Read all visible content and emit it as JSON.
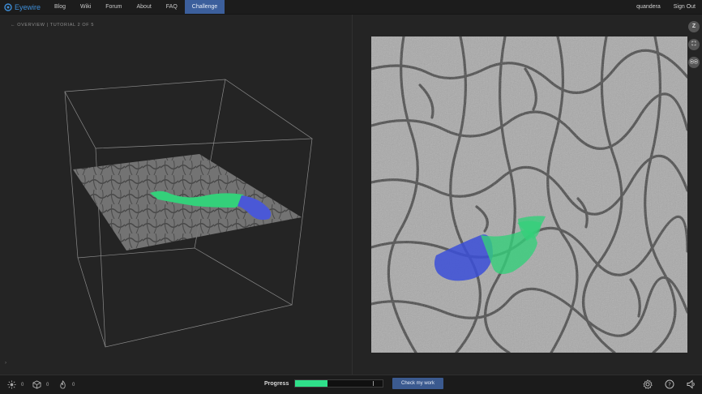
{
  "header": {
    "logo_text": "Eyewire",
    "nav": [
      {
        "label": "Blog"
      },
      {
        "label": "Wiki"
      },
      {
        "label": "Forum"
      },
      {
        "label": "About"
      },
      {
        "label": "FAQ"
      },
      {
        "label": "Challenge",
        "active": true
      }
    ],
    "username": "quandera",
    "sign_out": "Sign Out"
  },
  "left_panel": {
    "breadcrumb": "← OVERVIEW | TUTORIAL 2 OF 5",
    "collapse_arrow": "›"
  },
  "right_panel": {
    "buttons": [
      {
        "name": "z-button",
        "label": "Z"
      },
      {
        "name": "fullscreen-button",
        "label": "⛶"
      },
      {
        "name": "binoculars-button",
        "label": "⦿⦿"
      }
    ]
  },
  "footer": {
    "stats": [
      {
        "icon": "sun-icon",
        "value": "0"
      },
      {
        "icon": "cube-icon",
        "value": "0"
      },
      {
        "icon": "flame-icon",
        "value": "0"
      }
    ],
    "progress_label": "Progress",
    "progress_fraction": 0.37,
    "check_button": "Check my work",
    "icons": [
      "settings-icon",
      "help-icon",
      "sound-icon"
    ]
  },
  "colors": {
    "accent_blue": "#3c5f9c",
    "segment_green": "#2fe08a",
    "segment_blue": "#3b4fd8",
    "progress_fill": "#2fe08a"
  }
}
